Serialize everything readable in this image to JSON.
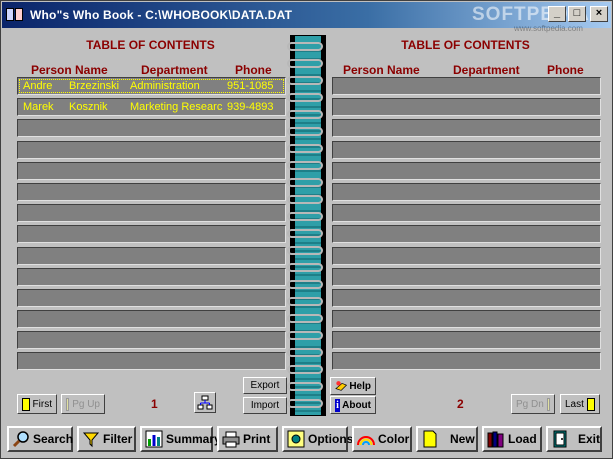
{
  "window": {
    "title": "Who\"s Who Book - C:\\WHOBOOK\\DATA.DAT",
    "watermark": "SOFTPEDIA",
    "watermark_sub": "www.softpedia.com",
    "controls": {
      "minimize": "_",
      "maximize": "□",
      "close": "×"
    }
  },
  "left_page": {
    "title": "TABLE OF CONTENTS",
    "columns": [
      "Person Name",
      "Department",
      "Phone"
    ],
    "rows": [
      {
        "first": "Andre",
        "last": "Brzezinski",
        "department": "Administration",
        "phone": "951-1085"
      },
      {
        "first": "Marek",
        "last": "Kosznik",
        "department": "Marketing Researc",
        "phone": "939-4893"
      },
      {},
      {},
      {},
      {},
      {},
      {},
      {},
      {},
      {},
      {},
      {},
      {}
    ],
    "page_number": "1",
    "first_label": "First",
    "prev_label": "Pg Up"
  },
  "right_page": {
    "title": "TABLE OF CONTENTS",
    "columns": [
      "Person Name",
      "Department",
      "Phone"
    ],
    "rows": [
      {},
      {},
      {},
      {},
      {},
      {},
      {},
      {},
      {},
      {},
      {},
      {},
      {},
      {}
    ],
    "page_number": "2",
    "last_label": "Last",
    "next_label": "Pg Dn"
  },
  "side_buttons": {
    "export": "Export",
    "import": "Import",
    "help": "Help",
    "about": "About"
  },
  "toolbar": {
    "search": "Search",
    "filter": "Filter",
    "summary": "Summary",
    "print": "Print",
    "options": "Options",
    "color": "Color",
    "new": "New",
    "load": "Load",
    "exit": "Exit"
  },
  "colors": {
    "header_text": "#8b0000",
    "row_text": "#ffff00",
    "row_bg": "#808080",
    "spine": "#2f9fa8"
  }
}
